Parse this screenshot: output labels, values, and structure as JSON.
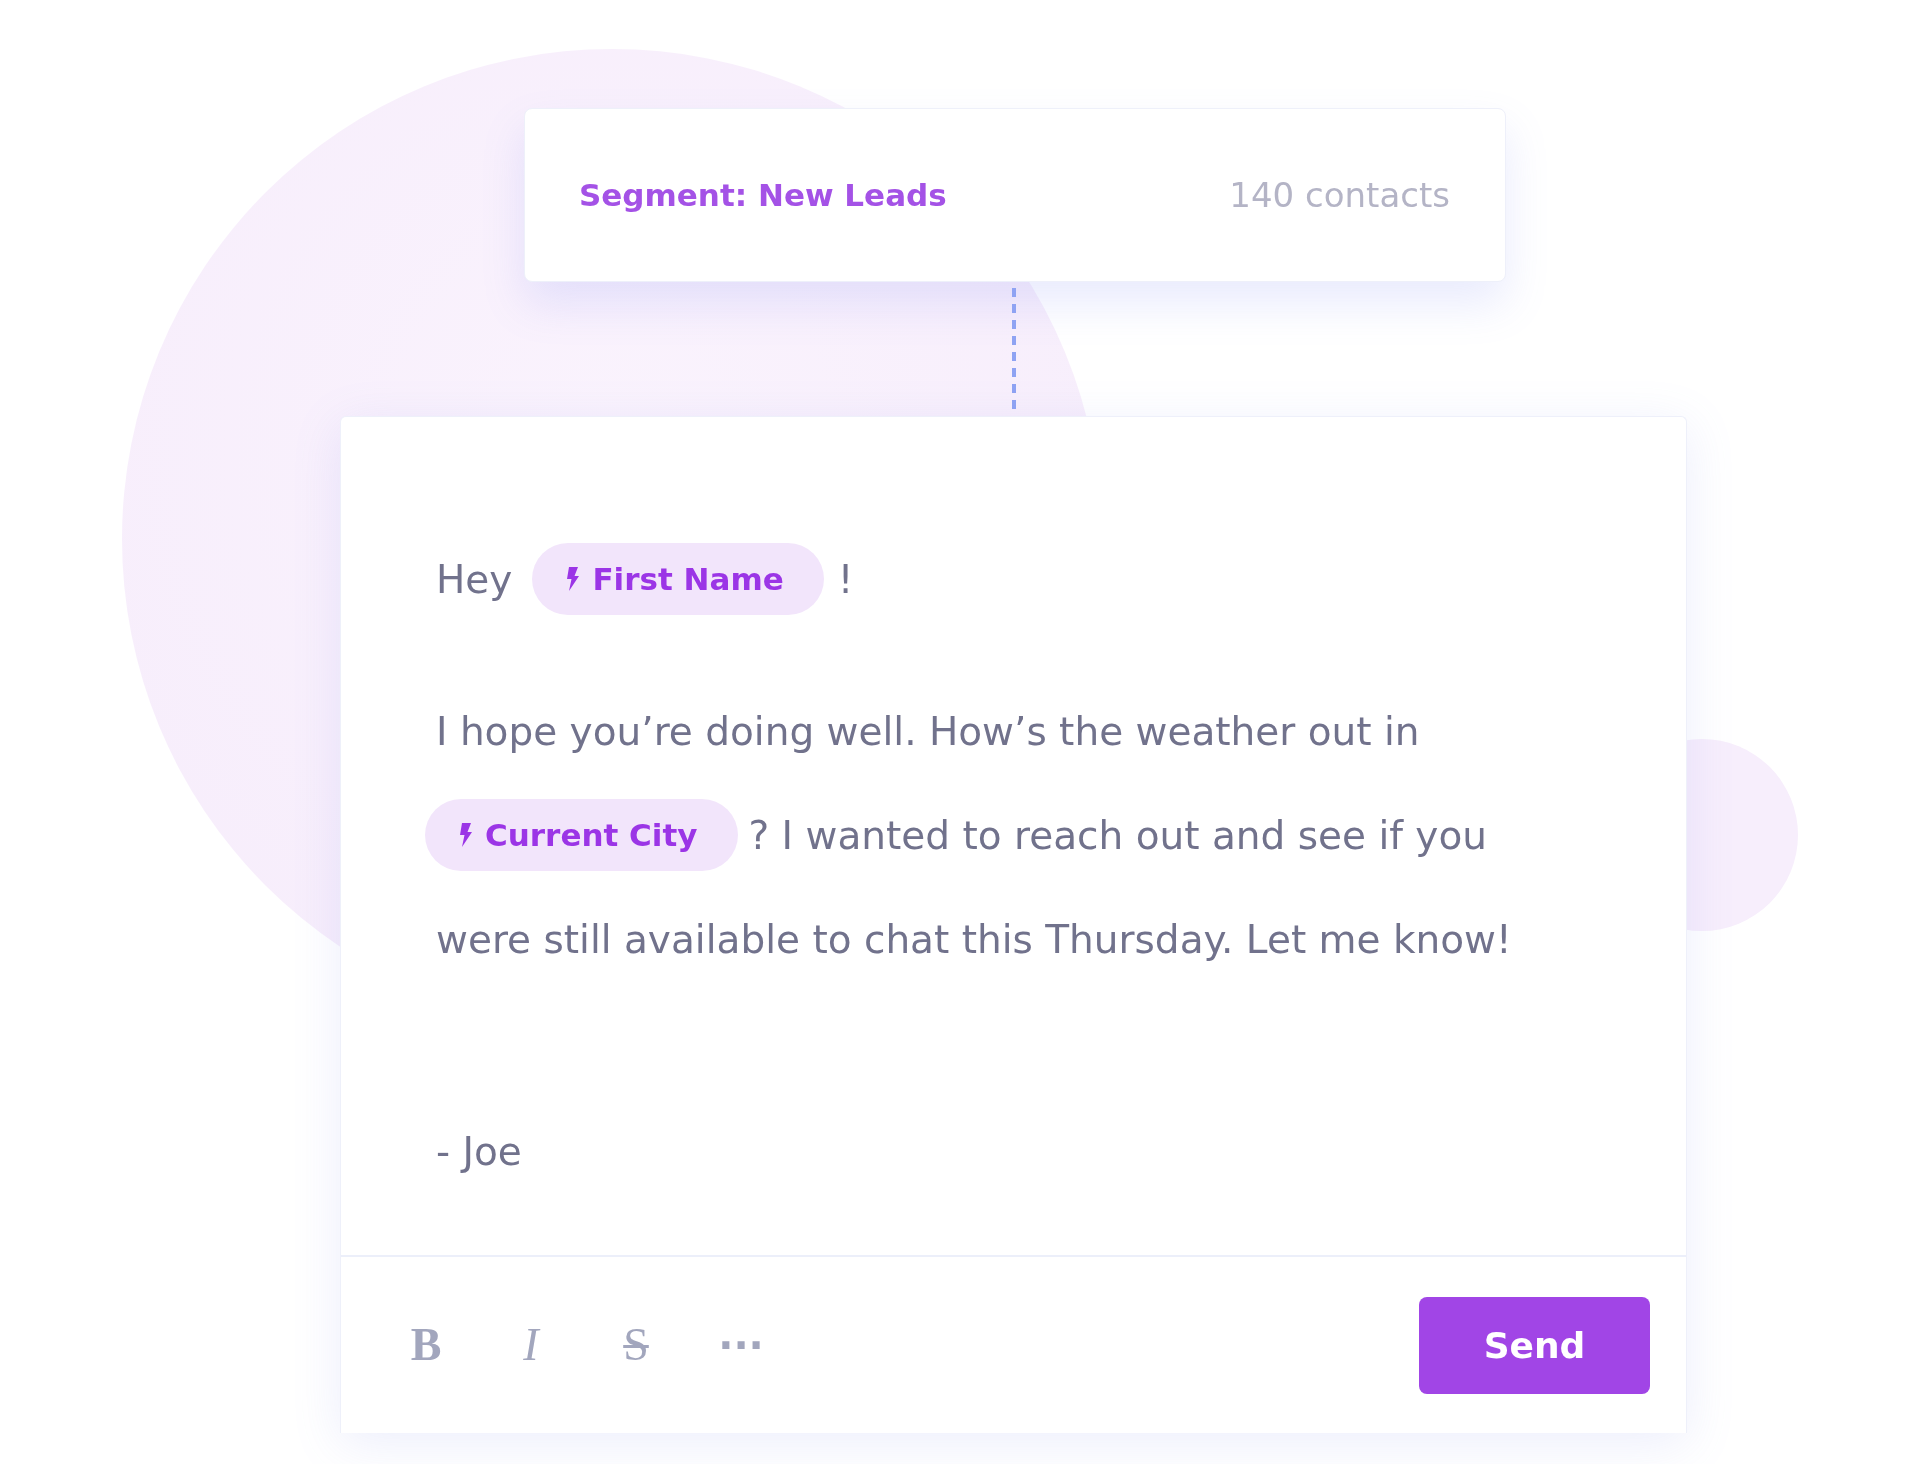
{
  "segment": {
    "label": "Segment: New Leads",
    "count": "140 contacts"
  },
  "message": {
    "paragraphs": [
      {
        "lines": [
          [
            {
              "kind": "text",
              "text": "Hey"
            },
            {
              "kind": "merge_tag",
              "label": "First Name"
            },
            {
              "kind": "text",
              "text": "!"
            }
          ]
        ]
      },
      {
        "lines": [
          [
            {
              "kind": "text",
              "text": "I hope you’re doing well. How’s the weather out in"
            }
          ],
          [
            {
              "kind": "merge_tag",
              "label": "Current City"
            },
            {
              "kind": "text",
              "text": "? I wanted to reach out and see if you"
            }
          ],
          [
            {
              "kind": "text",
              "text": "were still available to chat this Thursday. Let me know!"
            }
          ]
        ]
      },
      {
        "lines": [
          [
            {
              "kind": "text",
              "text": "- Joe"
            }
          ]
        ]
      }
    ]
  },
  "toolbar": {
    "format_buttons": [
      {
        "kind": "bold",
        "label": "B"
      },
      {
        "kind": "italic",
        "label": "I"
      },
      {
        "kind": "strikethrough",
        "label": "S"
      },
      {
        "kind": "more",
        "label": "···"
      }
    ],
    "send_button": "Send"
  }
}
